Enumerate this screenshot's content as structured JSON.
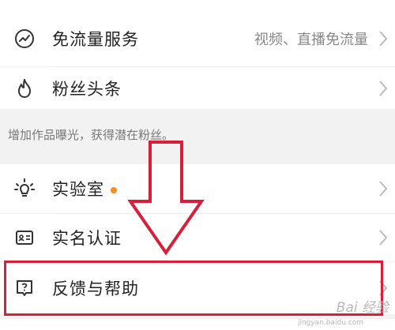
{
  "menu": {
    "free_data": {
      "label": "免流量服务",
      "value": "视频、直播免流量",
      "icon": "gauge-icon"
    },
    "fans_headline": {
      "label": "粉丝头条",
      "icon": "flame-icon"
    },
    "section_note": "增加作品曝光，获得潜在粉丝。",
    "lab": {
      "label": "实验室",
      "icon": "bulb-icon",
      "badge_color": "#ff8c1a"
    },
    "real_name": {
      "label": "实名认证",
      "icon": "id-card-icon"
    },
    "feedback": {
      "label": "反馈与帮助",
      "icon": "question-icon"
    }
  },
  "annotation": {
    "arrow_color": "#d81e3a",
    "box_color": "#d81e3a"
  },
  "watermark": {
    "text": "Bai 经验",
    "url": "jingyan.baidu.com"
  }
}
